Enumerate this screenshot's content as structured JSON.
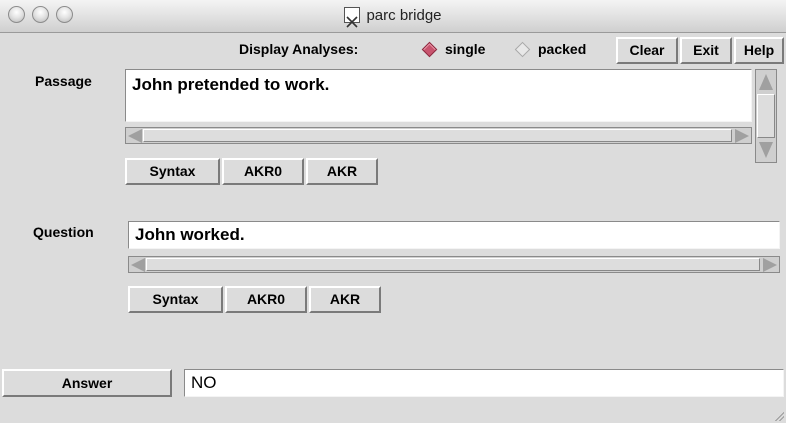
{
  "window": {
    "title": "parc bridge",
    "title_icon": "x11-icon"
  },
  "toolbar": {
    "display_label": "Display Analyses:",
    "single_label": "single",
    "packed_label": "packed",
    "selected_mode": "single",
    "clear_label": "Clear",
    "exit_label": "Exit",
    "help_label": "Help"
  },
  "passage": {
    "label": "Passage",
    "value": "John pretended to work.",
    "buttons": [
      "Syntax",
      "AKR0",
      "AKR"
    ]
  },
  "question": {
    "label": "Question",
    "value": "John worked.",
    "buttons": [
      "Syntax",
      "AKR0",
      "AKR"
    ]
  },
  "answer": {
    "button_label": "Answer",
    "value": "NO"
  },
  "colors": {
    "radio_selected": "#c8546e",
    "background": "#dcdcdc"
  }
}
